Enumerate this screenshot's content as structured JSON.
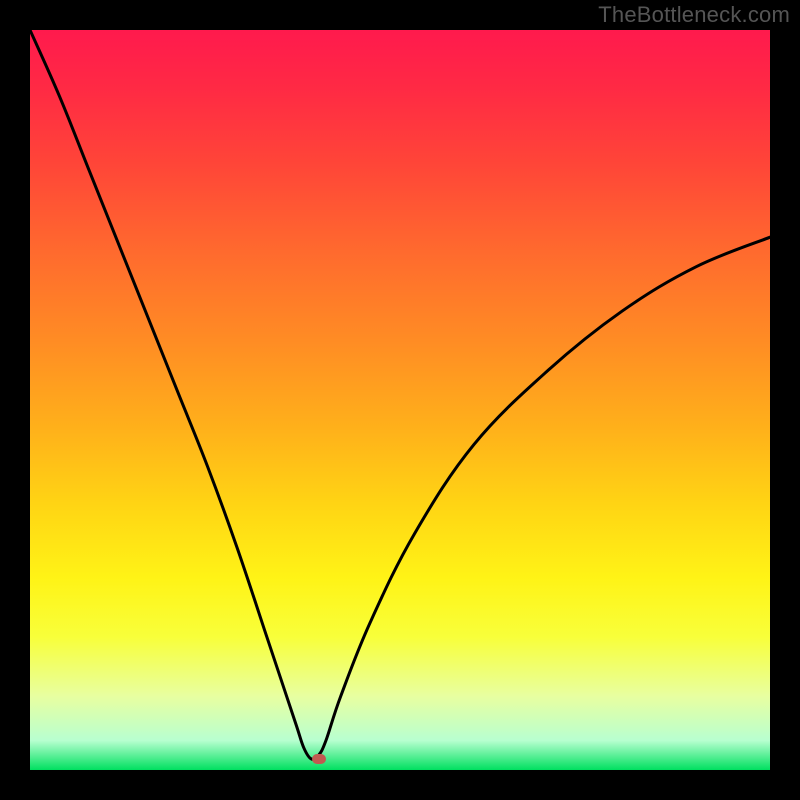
{
  "watermark": "TheBottleneck.com",
  "chart_data": {
    "type": "line",
    "title": "",
    "xlabel": "",
    "ylabel": "",
    "xlim": [
      0,
      100
    ],
    "ylim": [
      0,
      100
    ],
    "gradient_meaning": "background gradient: top=high bottleneck (red), bottom=balanced (green)",
    "optimum_x": 38,
    "marker": {
      "x": 39,
      "y": 1.5,
      "color": "#c05a50"
    },
    "series": [
      {
        "name": "bottleneck-curve",
        "x": [
          0,
          4,
          8,
          12,
          16,
          20,
          24,
          28,
          32,
          34,
          36,
          37,
          38,
          39,
          40,
          42,
          46,
          52,
          60,
          70,
          80,
          90,
          100
        ],
        "values": [
          100,
          91,
          81,
          71,
          61,
          51,
          41,
          30,
          18,
          12,
          6,
          3,
          1.5,
          2,
          4,
          10,
          20,
          32,
          44,
          54,
          62,
          68,
          72
        ]
      }
    ]
  }
}
